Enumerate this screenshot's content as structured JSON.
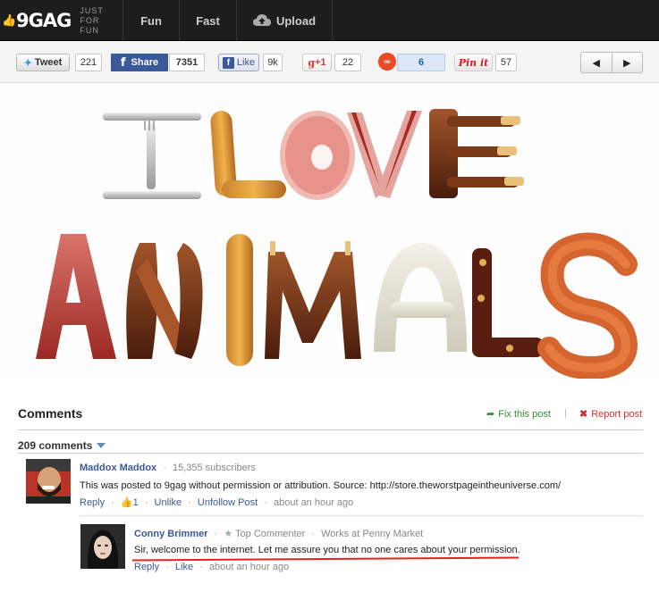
{
  "header": {
    "logo": "9GAG",
    "tagline_1": "JUST",
    "tagline_2": "FOR FUN",
    "nav": {
      "fun": "Fun",
      "fast": "Fast",
      "upload": "Upload"
    }
  },
  "share": {
    "tweet_label": "Tweet",
    "tweet_count": "221",
    "fb_share_label": "Share",
    "fb_share_count": "7351",
    "fb_like_label": "Like",
    "fb_like_count": "9k",
    "gplus_label": "+1",
    "gplus_count": "22",
    "stumble_count": "6",
    "pinit_label": "Pin it",
    "pin_count": "57"
  },
  "post": {
    "line1": "I LOVE",
    "line2": "ANIMALS"
  },
  "comments": {
    "title": "Comments",
    "fix_post": "Fix this post",
    "separator": "|",
    "report_post": "Report post",
    "count_label": "209 comments",
    "items": [
      {
        "name": "Maddox Maddox",
        "meta": "15,355 subscribers",
        "text": "This was posted to 9gag without permission or attribution. Source: http://store.theworstpageintheuniverse.com/",
        "reply": "Reply",
        "likes": "1",
        "unlike": "Unlike",
        "unfollow": "Unfollow Post",
        "time": "about an hour ago"
      },
      {
        "name": "Conny Brimmer",
        "badge": "Top Commenter",
        "work": "Works at Penny Market",
        "text": "Sir, welcome to the internet. Let me assure you that no one cares about your permission.",
        "reply": "Reply",
        "like": "Like",
        "time": "about an hour ago"
      }
    ]
  },
  "colors": {
    "topbar": "#1d1d1d",
    "facebook": "#3b5998",
    "fix_green": "#3a8a3a",
    "report_red": "#cc3333",
    "underline_red": "#e32222"
  }
}
